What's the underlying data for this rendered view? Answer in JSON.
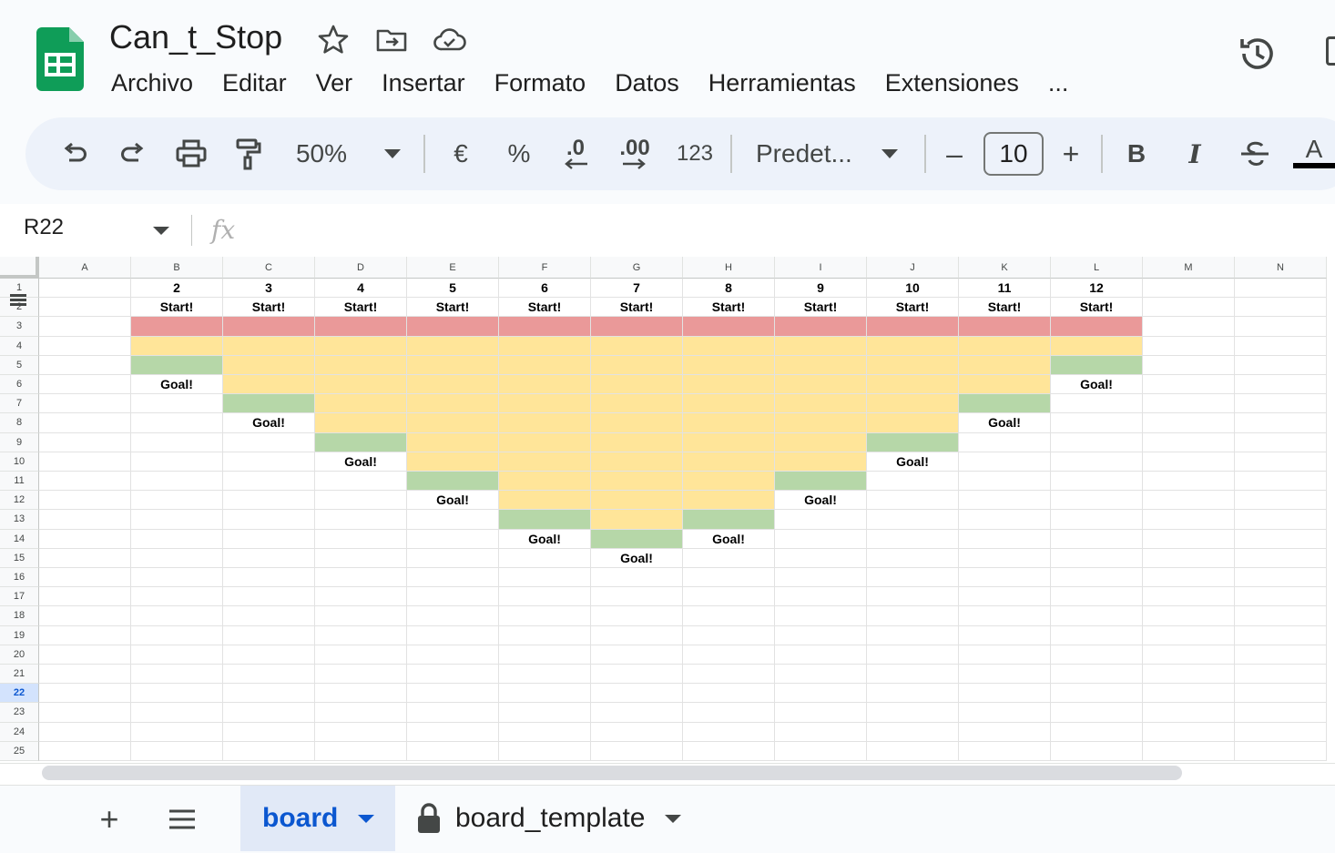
{
  "app": {
    "doc_title": "Can_t_Stop",
    "menu": [
      "Archivo",
      "Editar",
      "Ver",
      "Insertar",
      "Formato",
      "Datos",
      "Herramientas",
      "Extensiones",
      "..."
    ]
  },
  "toolbar": {
    "zoom": "50%",
    "currency": "€",
    "percent": "%",
    "dec_decrease": ".0",
    "dec_increase": ".00",
    "number_format": "123",
    "font_name": "Predet...",
    "font_size_minus": "–",
    "font_size": "10",
    "font_size_plus": "+",
    "bold": "B",
    "italic": "I",
    "text_color": "A"
  },
  "formula_bar": {
    "name_box": "R22",
    "fx": "fx",
    "value": ""
  },
  "grid": {
    "columns": [
      "A",
      "B",
      "C",
      "D",
      "E",
      "F",
      "G",
      "H",
      "I",
      "J",
      "K",
      "L",
      "M",
      "N"
    ],
    "rows": [
      "1",
      "2",
      "3",
      "4",
      "5",
      "6",
      "7",
      "8",
      "9",
      "10",
      "11",
      "12",
      "13",
      "14",
      "15",
      "16",
      "17",
      "18",
      "19",
      "20",
      "21",
      "22",
      "23",
      "24",
      "25"
    ],
    "selected_row": "22",
    "selected_cell": "R22",
    "board_columns": [
      {
        "col": "B",
        "number": "2",
        "goal_row": 5
      },
      {
        "col": "C",
        "number": "3",
        "goal_row": 7
      },
      {
        "col": "D",
        "number": "4",
        "goal_row": 9
      },
      {
        "col": "E",
        "number": "5",
        "goal_row": 11
      },
      {
        "col": "F",
        "number": "6",
        "goal_row": 13
      },
      {
        "col": "G",
        "number": "7",
        "goal_row": 14
      },
      {
        "col": "H",
        "number": "8",
        "goal_row": 13
      },
      {
        "col": "I",
        "number": "9",
        "goal_row": 11
      },
      {
        "col": "J",
        "number": "10",
        "goal_row": 9
      },
      {
        "col": "K",
        "number": "11",
        "goal_row": 7
      },
      {
        "col": "L",
        "number": "12",
        "goal_row": 5
      }
    ],
    "start_label": "Start!",
    "goal_label": "Goal!",
    "colors": {
      "start_row": "#ea9999",
      "track": "#ffe599",
      "goal": "#b6d7a8",
      "selected_header": "#d3e3fd"
    }
  },
  "sheets": {
    "add": "+",
    "list": "≡",
    "tabs": [
      {
        "name": "board",
        "active": true,
        "locked": false
      },
      {
        "name": "board_template",
        "active": false,
        "locked": true
      }
    ]
  }
}
